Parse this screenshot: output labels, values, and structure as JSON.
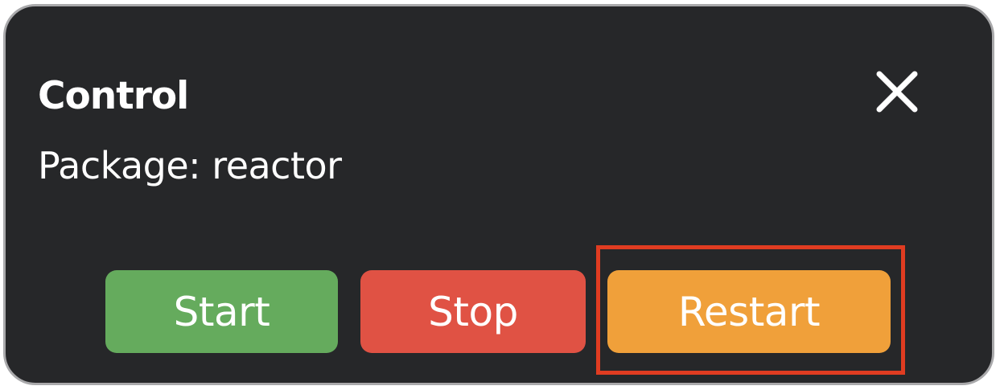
{
  "dialog": {
    "title": "Control",
    "subtitle": "Package: reactor",
    "close_icon": "close-icon"
  },
  "buttons": {
    "start": {
      "label": "Start",
      "color": "#65ab5d"
    },
    "stop": {
      "label": "Stop",
      "color": "#e05244"
    },
    "restart": {
      "label": "Restart",
      "color": "#f0a03a"
    }
  },
  "colors": {
    "panel_background": "#262729",
    "panel_border": "#a9a9ab",
    "highlight_border": "#e03c21",
    "text": "#ffffff"
  }
}
